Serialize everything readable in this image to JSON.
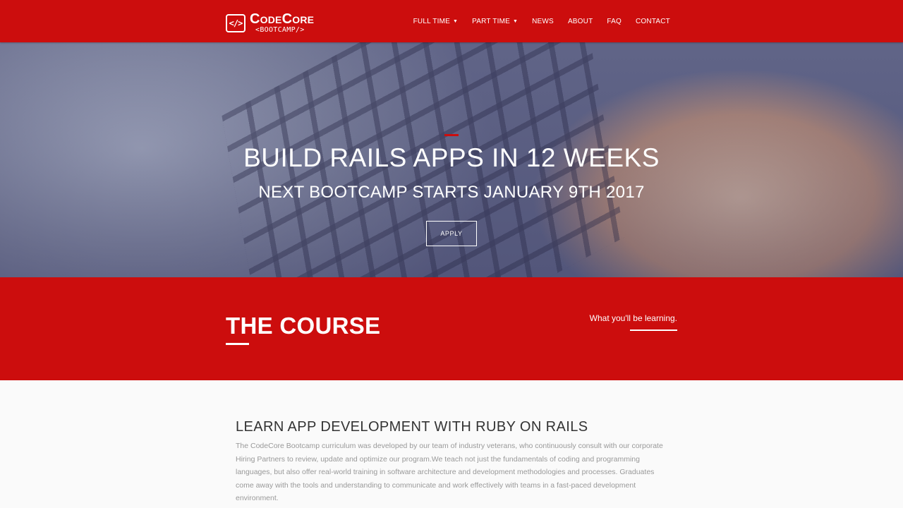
{
  "brand": {
    "logo_glyph": "</>",
    "name": "CodeCore",
    "subtitle": "<BOOTCAMP/>",
    "accent_color": "#cc0d0d"
  },
  "nav": {
    "items": [
      {
        "label": "FULL TIME",
        "has_dropdown": true
      },
      {
        "label": "PART TIME",
        "has_dropdown": true
      },
      {
        "label": "NEWS",
        "has_dropdown": false
      },
      {
        "label": "ABOUT",
        "has_dropdown": false
      },
      {
        "label": "FAQ",
        "has_dropdown": false
      },
      {
        "label": "CONTACT",
        "has_dropdown": false
      }
    ],
    "caret": "▼"
  },
  "hero": {
    "title": "BUILD RAILS APPS IN 12 WEEKS",
    "subtitle": "NEXT BOOTCAMP STARTS JANUARY 9TH 2017",
    "apply_label": "APPLY"
  },
  "course": {
    "title": "THE COURSE",
    "tagline": "What you'll be learning."
  },
  "content": {
    "heading": "LEARN APP DEVELOPMENT WITH RUBY ON RAILS",
    "body": "The CodeCore Bootcamp curriculum was developed by our team of industry veterans, who continuously consult with our corporate Hiring Partners to review, update and optimize our program.We teach not just the fundamentals of coding and programming languages, but also offer real-world training in software architecture and development methodologies and processes. Graduates come away with the tools and understanding to communicate and work effectively with teams in a fast-paced development environment."
  }
}
